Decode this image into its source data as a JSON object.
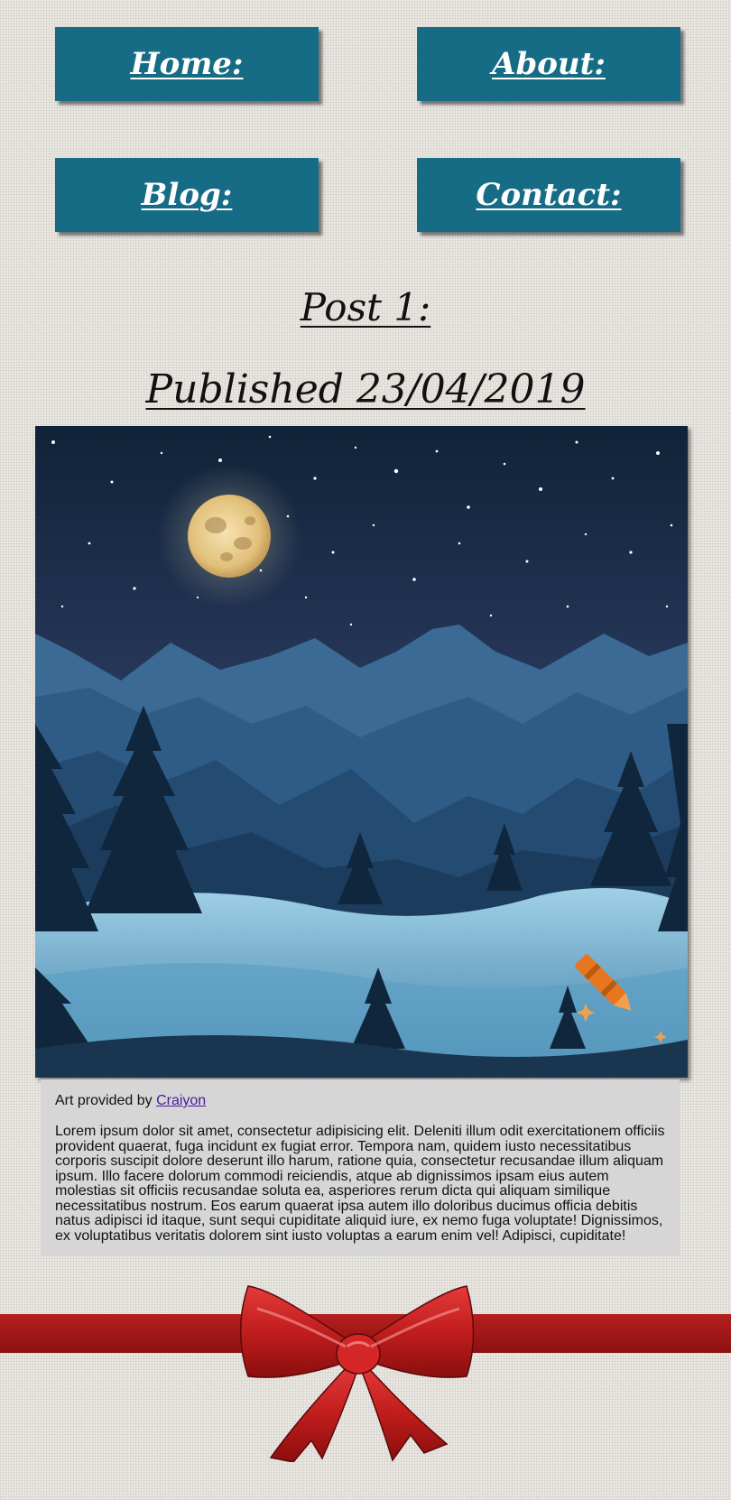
{
  "nav": {
    "home": "Home:",
    "about": "About:",
    "blog": "Blog:",
    "contact": "Contact:"
  },
  "post": {
    "title": "Post 1:",
    "date": "Published 23/04/2019",
    "credit_prefix": "Art provided by",
    "credit_link": "Craiyon",
    "body": "Lorem ipsum dolor sit amet, consectetur adipisicing elit. Deleniti illum odit exercitationem officiis provident quaerat, fuga incidunt ex fugiat error. Tempora nam, quidem iusto necessitatibus corporis suscipit dolore deserunt illo harum, ratione quia, consectetur recusandae illum aliquam ipsum. Illo facere dolorum commodi reiciendis, atque ab dignissimos ipsam eius autem molestias sit officiis recusandae soluta ea, asperiores rerum dicta qui aliquam similique necessitatibus nostrum. Eos earum quaerat ipsa autem illo doloribus ducimus officia debitis natus adipisci id itaque, sunt sequi cupiditate aliquid iure, ex nemo fuga voluptate! Dignissimos, ex voluptatibus veritatis dolorem sint iusto voluptas a earum enim vel! Adipisci, cupiditate!"
  },
  "colors": {
    "nav_button": "#166c84",
    "ribbon": "#a51a1a",
    "text_box": "#d6d6d6",
    "link": "#4b1a9c"
  },
  "icons": {
    "watermark": "crayon-icon"
  }
}
